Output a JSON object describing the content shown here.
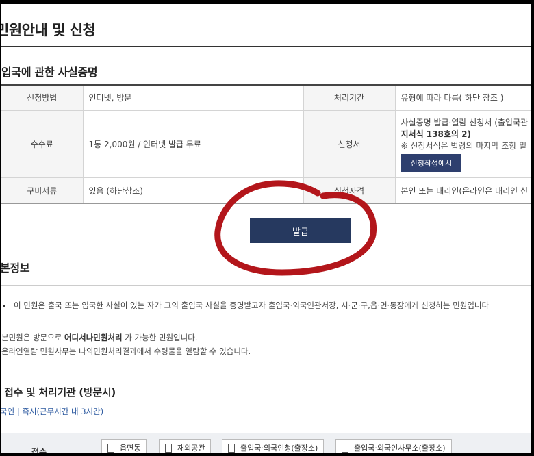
{
  "page": {
    "title": "민원안내 및 신청"
  },
  "section1": {
    "title": "입국에 관한 사실증명",
    "rows": [
      {
        "label1": "신청방법",
        "value1": "인터넷, 방문",
        "label2": "처리기간",
        "value2": "유형에 따라 다름( 하단 참조 )"
      },
      {
        "label1": "수수료",
        "value1": "1통 2,000원 / 인터넷 발급 무료",
        "label2": "신청서",
        "value2_line1": "사실증명 발급·열람 신청서 (출입국관",
        "value2_line2": "지서식 138호의 2)",
        "value2_note": "※ 신청서식은 법령의 마지막 조항 밑",
        "example_button": "신청작성예시"
      },
      {
        "label1": "구비서류",
        "value1": "있음 (하단참조)",
        "label2": "신청자격",
        "value2": "본인 또는 대리인(온라인은 대리인 신"
      }
    ]
  },
  "issue_button": "발급",
  "section2": {
    "title": "본정보",
    "bullet": "이 민원은 출국 또는 입국한 사실이 있는 자가 그의 출입국 사실을 증명받고자 출입국·외국인관서장, 시·군·구,읍·면·동장에게 신청하는 민원입니다",
    "line1_pre": "본민원은 방문으로 ",
    "line1_bold": "어디서나민원처리",
    "line1_post": " 가 가능한 민원입니다.",
    "line2": "온라인열람 민원사무는 나의민원처리결과에서 수령물을 열람할 수 있습니다."
  },
  "section3": {
    "title": "접수 및 처리기관 (방문시)",
    "org_line": "국인 | 즉시(근무시간 내 3시간)",
    "receipt_label": "접수",
    "chips": [
      "읍면동",
      "재외공관",
      "출입국·외국인청(출장소)",
      "출입국·외국인사무소(출장소)"
    ]
  },
  "annotation": {
    "color": "#b3161b"
  }
}
